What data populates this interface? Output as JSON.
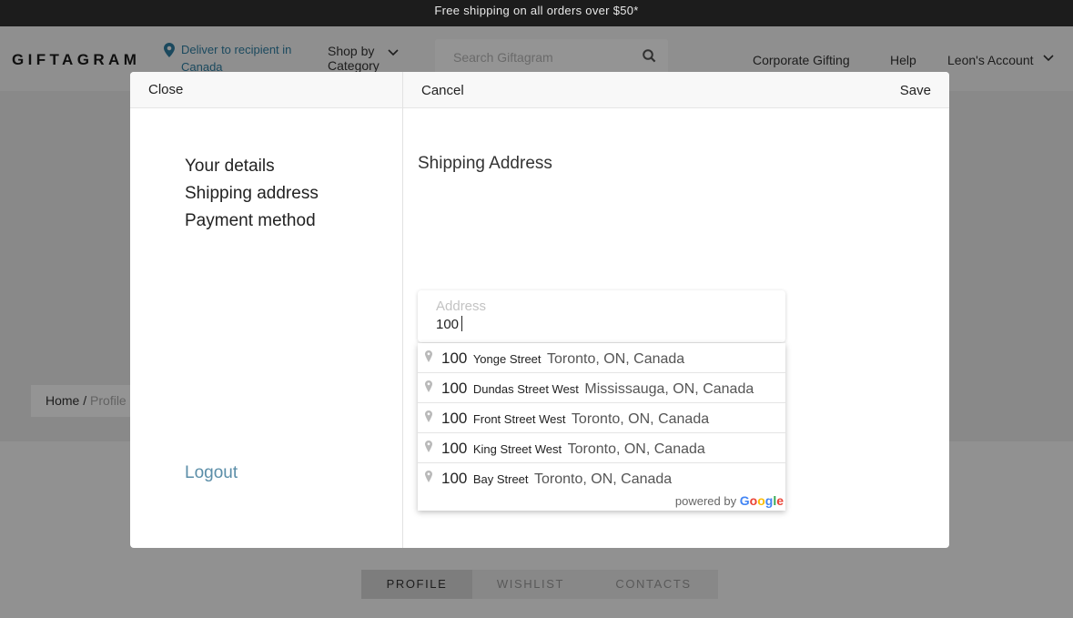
{
  "promo": {
    "text": "Free shipping on all orders over $50*"
  },
  "header": {
    "logo": "GIFTAGRAM",
    "deliver": "Deliver to recipient in Canada",
    "shop_by": "Shop by Category",
    "search_placeholder": "Search Giftagram",
    "links": {
      "corporate": "Corporate Gifting",
      "help": "Help",
      "account": "Leon's Account"
    },
    "colors": {
      "accent": "#2f7fa3"
    }
  },
  "page": {
    "breadcrumb": {
      "home": "Home",
      "separator": " / ",
      "current": "Profile"
    },
    "tabs": [
      "PROFILE",
      "WISHLIST",
      "CONTACTS"
    ],
    "active_tab": "PROFILE"
  },
  "modal": {
    "close_label": "Close",
    "cancel_label": "Cancel",
    "save_label": "Save",
    "nav": [
      "Your details",
      "Shipping address",
      "Payment method"
    ],
    "logout_label": "Logout",
    "section_title": "Shipping Address",
    "address_field": {
      "label": "Address",
      "value": "100"
    },
    "suggestions": [
      {
        "number": "100",
        "street": "Yonge Street",
        "city": "Toronto, ON, Canada"
      },
      {
        "number": "100",
        "street": "Dundas Street West",
        "city": "Mississauga, ON, Canada"
      },
      {
        "number": "100",
        "street": "Front Street West",
        "city": "Toronto, ON, Canada"
      },
      {
        "number": "100",
        "street": "King Street West",
        "city": "Toronto, ON, Canada"
      },
      {
        "number": "100",
        "street": "Bay Street",
        "city": "Toronto, ON, Canada"
      }
    ],
    "powered_by": "powered by",
    "powered_brand": [
      "G",
      "o",
      "o",
      "g",
      "l",
      "e"
    ]
  }
}
